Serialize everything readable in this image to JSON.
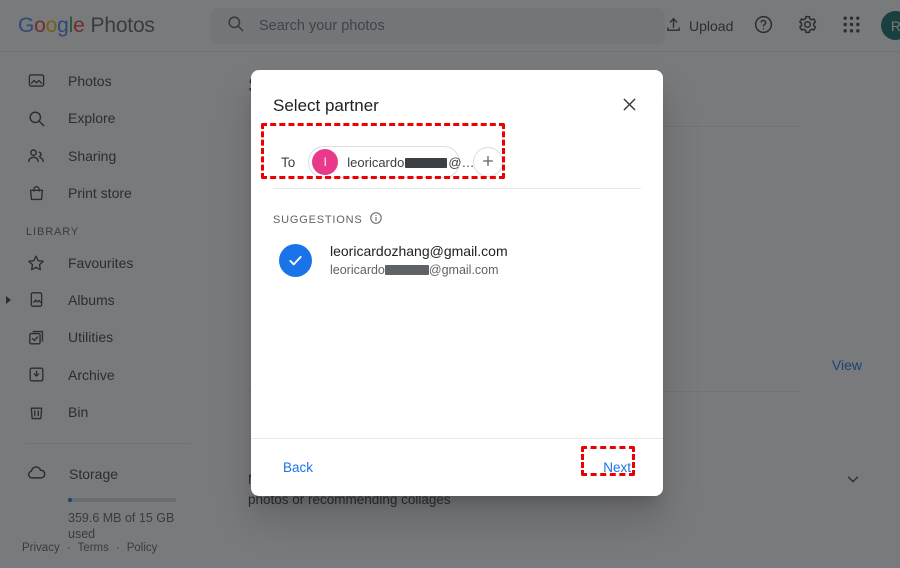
{
  "header": {
    "brand_google": "Google",
    "brand_word": "Photos",
    "brand_letters": [
      "G",
      "o",
      "o",
      "g",
      "l",
      "e"
    ],
    "search": {
      "placeholder": "Search your photos",
      "value": "",
      "icon": "search-icon"
    },
    "upload_label": "Upload",
    "upload_icon": "upload-icon",
    "help_icon": "help-circle-icon",
    "settings_icon": "gear-icon",
    "apps_icon": "apps-grid-icon",
    "avatar": {
      "initial": "R",
      "color": "#0f6b6b"
    }
  },
  "sidebar": {
    "items": [
      {
        "label": "Photos",
        "icon": "photo-icon"
      },
      {
        "label": "Explore",
        "icon": "search-icon"
      },
      {
        "label": "Sharing",
        "icon": "people-icon"
      },
      {
        "label": "Print store",
        "icon": "shopping-bag-icon"
      }
    ],
    "section_label": "Library",
    "library_items": [
      {
        "label": "Favourites",
        "icon": "star-icon",
        "expandable": false
      },
      {
        "label": "Albums",
        "icon": "album-icon",
        "expandable": true
      },
      {
        "label": "Utilities",
        "icon": "utilities-icon",
        "expandable": false
      },
      {
        "label": "Archive",
        "icon": "archive-icon",
        "expandable": false
      },
      {
        "label": "Bin",
        "icon": "trash-icon",
        "expandable": false
      }
    ],
    "storage": {
      "label": "Storage",
      "icon": "cloud-icon",
      "usage_text": "359.6 MB of 15 GB used",
      "percent": 2.3
    },
    "footer_links": [
      "Privacy",
      "Terms",
      "Policy"
    ],
    "footer_separator": "·"
  },
  "content": {
    "title": "Settings",
    "view_link": "View",
    "suggestions_desc": "Manage the types of suggestions that you see, like fixing sideways photos or recommending collages",
    "chevron_icon": "chevron-down-icon"
  },
  "modal": {
    "title": "Select partner",
    "close_icon": "close-icon",
    "to_label": "To",
    "chip": {
      "avatar_initial": "l",
      "avatar_color": "#E8398B",
      "text_before": "leoricardo",
      "text_after": "@…",
      "redacted": true
    },
    "add_icon": "plus-icon",
    "suggestions_label": "Suggestions",
    "suggestions_info_icon": "info-icon",
    "suggestions": [
      {
        "primary": "leoricardozhang@gmail.com",
        "secondary_before": "leoricardo",
        "secondary_after": "@gmail.com",
        "selected": true,
        "check_icon": "check-circle-icon"
      }
    ],
    "back_label": "Back",
    "next_label": "Next"
  },
  "annotations": {
    "color": "#ee0000",
    "boxes": [
      {
        "name": "to-field-highlight",
        "target": "to-row"
      },
      {
        "name": "next-button-highlight",
        "target": "next-button"
      }
    ]
  }
}
